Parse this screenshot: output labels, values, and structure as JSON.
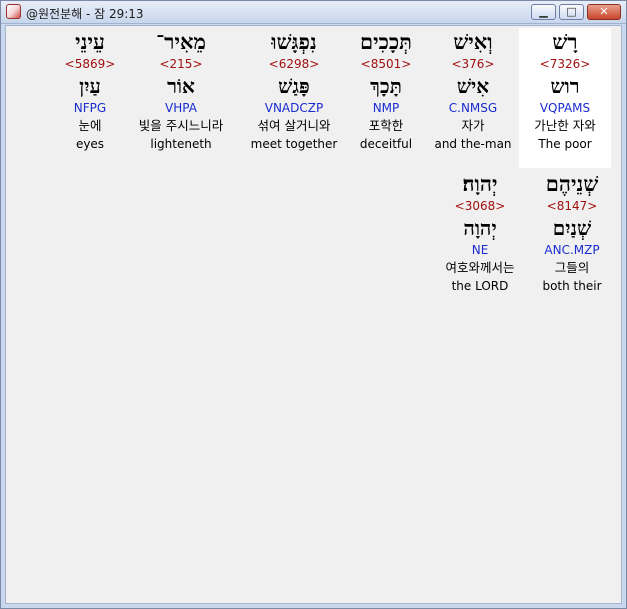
{
  "window": {
    "title": "@원전분해 - 잠 29:13",
    "minimize": "▁",
    "maximize": "□",
    "close": "✕"
  },
  "words": [
    {
      "hebrew": "רָשׁ",
      "strong": "<7326>",
      "lemma": "רוש",
      "morph": "VQPAMS",
      "korean": "가난한 자와",
      "english": "The poor",
      "highlight": true
    },
    {
      "hebrew": "וְאִישׁ",
      "strong": "<376>",
      "lemma": "אִישׁ",
      "morph": "C.NMSG",
      "korean": "자가",
      "english": "and the-man",
      "highlight": false
    },
    {
      "hebrew": "תְּכָכִים",
      "strong": "<8501>",
      "lemma": "תָּכָךְ",
      "morph": "NMP",
      "korean": "포학한",
      "english": "deceitful",
      "highlight": false
    },
    {
      "hebrew": "נִפְגָּשׁוּ",
      "strong": "<6298>",
      "lemma": "פָּגַשׁ",
      "morph": "VNADCZP",
      "korean": "섞여 살거니와",
      "english": "meet together",
      "highlight": false
    },
    {
      "hebrew": "מֵאִיר־",
      "strong": "<215>",
      "lemma": "אוֹר",
      "morph": "VHPA",
      "korean": "빛을 주시느니라",
      "english": "lighteneth",
      "highlight": false
    },
    {
      "hebrew": "עֵינֵי",
      "strong": "<5869>",
      "lemma": "עַיִן",
      "morph": "NFPG",
      "korean": "눈에",
      "english": "eyes",
      "highlight": false
    },
    {
      "hebrew": "שְׁנֵיהֶם",
      "strong": "<8147>",
      "lemma": "שְׁנַיִם",
      "morph": "ANC.MZP",
      "korean": "그들의",
      "english": "both their",
      "highlight": false
    },
    {
      "hebrew": "יְהוָה׃",
      "strong": "<3068>",
      "lemma": "יְהוָה",
      "morph": "NE",
      "korean": "여호와께서는",
      "english": "the LORD",
      "highlight": false
    }
  ]
}
